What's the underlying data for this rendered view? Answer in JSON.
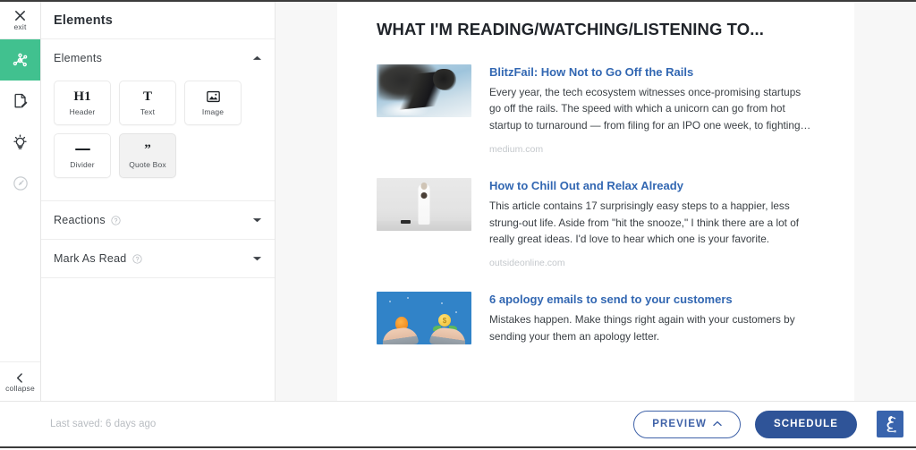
{
  "rail": {
    "items": [
      {
        "label": "exit",
        "icon": "close-icon",
        "state": "default"
      },
      {
        "label": "",
        "icon": "network-nodes-icon",
        "state": "active"
      },
      {
        "label": "",
        "icon": "document-edit-icon",
        "state": "default"
      },
      {
        "label": "",
        "icon": "lightbulb-icon",
        "state": "default"
      },
      {
        "label": "",
        "icon": "gauge-icon",
        "state": "disabled"
      }
    ],
    "collapse_label": "collapse",
    "collapse_icon": "chevron-left-icon",
    "active_color": "#41c18f"
  },
  "panel": {
    "header_title": "Elements",
    "sections": [
      {
        "title": "Elements",
        "expanded": true,
        "chevron": "chevron-up-icon",
        "has_help": false
      },
      {
        "title": "Reactions",
        "expanded": false,
        "chevron": "chevron-down-icon",
        "has_help": true,
        "help_icon": "help-circle-icon"
      },
      {
        "title": "Mark As Read",
        "expanded": false,
        "chevron": "chevron-down-icon",
        "has_help": true,
        "help_icon": "help-circle-icon"
      }
    ],
    "element_cards": [
      {
        "glyph": "H1",
        "label": "Header",
        "icon": "heading-icon",
        "hovered": false
      },
      {
        "glyph": "T",
        "label": "Text",
        "icon": "text-icon",
        "hovered": false
      },
      {
        "glyph": "",
        "label": "Image",
        "icon": "image-icon",
        "hovered": false
      },
      {
        "glyph": "",
        "label": "Divider",
        "icon": "divider-icon",
        "hovered": false
      },
      {
        "glyph": "”",
        "label": "Quote Box",
        "icon": "quote-icon",
        "hovered": true
      }
    ]
  },
  "canvas": {
    "title": "WHAT I'M READING/WATCHING/LISTENING TO...",
    "articles": [
      {
        "title": "BlitzFail: How Not to Go Off the Rails",
        "description": "Every year, the tech ecosystem witnesses once-promising startups go off the rails. The speed with which a unicorn can go from hot startup to turnaround — from filing for an IPO one week, to fighting…",
        "source": "medium.com",
        "thumb": "crashed-machine-photo"
      },
      {
        "title": "How to Chill Out and Relax Already",
        "description": "This article contains 17 surprisingly easy steps to a happier, less strung-out life. Aside from \"hit the snooze,\" I think there are a lot of really great ideas. I'd love to hear which one is your favorite.",
        "source": "outsideonline.com",
        "thumb": "person-in-white-photo"
      },
      {
        "title": "6 apology emails to send to your customers",
        "description": "Mistakes happen. Make things right again with your customers by sending your them an apology letter.",
        "source": "",
        "thumb": "lightbulb-and-money-plant-illustration"
      }
    ],
    "link_color": "#3267b2"
  },
  "bottom_bar": {
    "saved_text": "Last saved: 6 days ago",
    "preview_label": "PREVIEW",
    "preview_chevron": "chevron-up-icon",
    "schedule_label": "SCHEDULE",
    "logo": "bird-logo-icon",
    "schedule_color": "#2f5498",
    "preview_color": "#3f62a8"
  }
}
